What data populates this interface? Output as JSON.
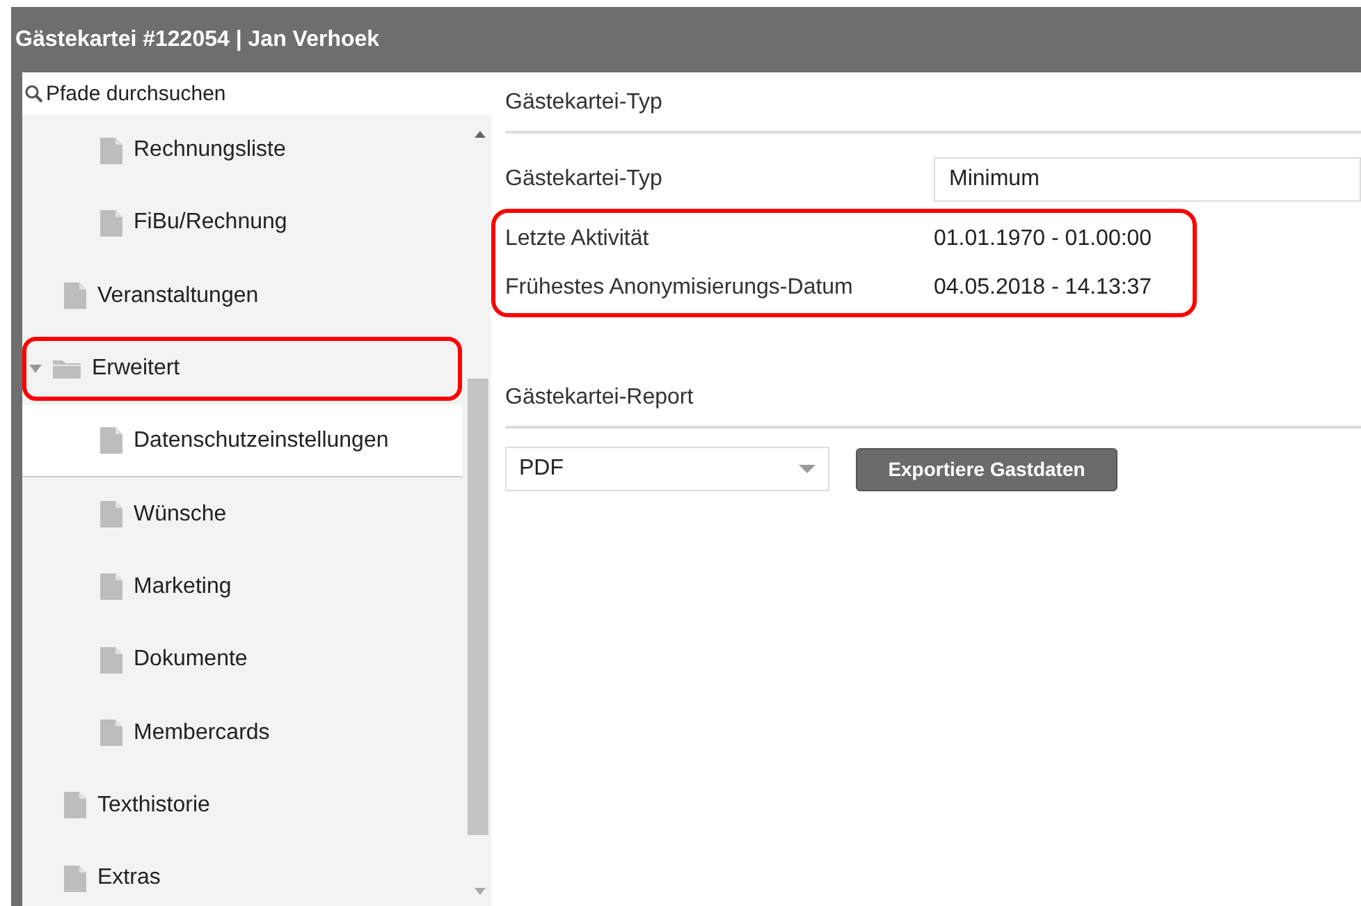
{
  "window": {
    "title": "Gästekartei #122054 | Jan Verhoek"
  },
  "search": {
    "placeholder": "Pfade durchsuchen"
  },
  "tree": [
    {
      "children": [
        {
          "label": "Rechnungsliste",
          "kind": "file",
          "selected": false
        },
        {
          "label": "FiBu/Rechnung",
          "kind": "file",
          "selected": false
        }
      ]
    },
    {
      "label": "Veranstaltungen",
      "kind": "file",
      "selected": false
    },
    {
      "label": "Erweitert",
      "kind": "folder",
      "selected": false,
      "expanded": true,
      "highlighted": true,
      "children": [
        {
          "label": "Datenschutzeinstellungen",
          "kind": "file",
          "selected": true
        },
        {
          "label": "Wünsche",
          "kind": "file",
          "selected": false
        },
        {
          "label": "Marketing",
          "kind": "file",
          "selected": false
        },
        {
          "label": "Dokumente",
          "kind": "file",
          "selected": false
        },
        {
          "label": "Membercards",
          "kind": "file",
          "selected": false
        }
      ]
    },
    {
      "label": "Texthistorie",
      "kind": "file",
      "selected": false
    },
    {
      "label": "Extras",
      "kind": "file",
      "selected": false
    }
  ],
  "sections": [
    {
      "title": "Gästekartei-Typ",
      "rows": [
        {
          "kind": "select",
          "label": "Gästekartei-Typ",
          "value": "Minimum"
        },
        {
          "kind": "group",
          "highlighted": true,
          "rows": [
            {
              "label": "Letzte Aktivität",
              "value": "01.01.1970 - 01.00:00"
            },
            {
              "label": "Frühestes Anonymisierungs-Datum",
              "value": "04.05.2018 - 14.13:37"
            }
          ]
        }
      ]
    },
    {
      "title": "Gästekartei-Report",
      "report": {
        "format": "PDF",
        "button": "Exportiere Gastdaten"
      }
    }
  ]
}
